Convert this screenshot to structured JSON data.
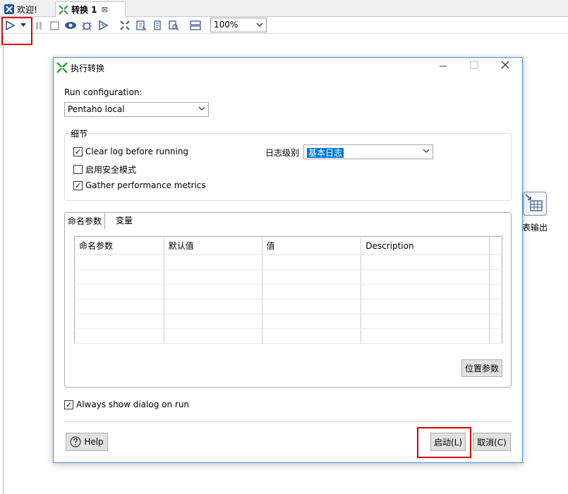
{
  "tabs": [
    {
      "label": "欢迎!",
      "icon": "spoon-icon"
    },
    {
      "label": "转换 1",
      "icon": "transform-icon",
      "close": "⊠"
    }
  ],
  "toolbar": {
    "zoom_value": "100%",
    "buttons": [
      "run-icon",
      "run-dropdown-icon",
      "pause-icon",
      "stop-icon",
      "preview-icon",
      "debug-icon",
      "replay-icon",
      "verify-icon",
      "impact-icon",
      "sql-icon",
      "explore-db-icon",
      "show-results-icon"
    ]
  },
  "canvas": {
    "step_label": "表输出"
  },
  "dialog": {
    "title": "执行转换",
    "run_config_label": "Run configuration:",
    "run_config_value": "Pentaho local",
    "details_group": "细节",
    "clear_log": {
      "label": "Clear log before running",
      "checked": true
    },
    "safe_mode": {
      "label": "启用安全模式",
      "checked": false
    },
    "gather_metrics": {
      "label": "Gather performance metrics",
      "checked": true
    },
    "log_level_label": "日志级别",
    "log_level_value": "基本日志",
    "param_tabs": [
      "命名参数",
      "变量"
    ],
    "table_headers": [
      "命名参数",
      "默认值",
      "值",
      "Description"
    ],
    "position_params_button": "位置参数",
    "always_show": {
      "label": "Always show dialog on run",
      "checked": true
    },
    "help_button": "Help",
    "start_button": "启动(L)",
    "cancel_button": "取消(C)"
  },
  "colors": {
    "accent": "#0078d7",
    "highlight": "#e00000",
    "dialog_border": "#4a90d9"
  }
}
